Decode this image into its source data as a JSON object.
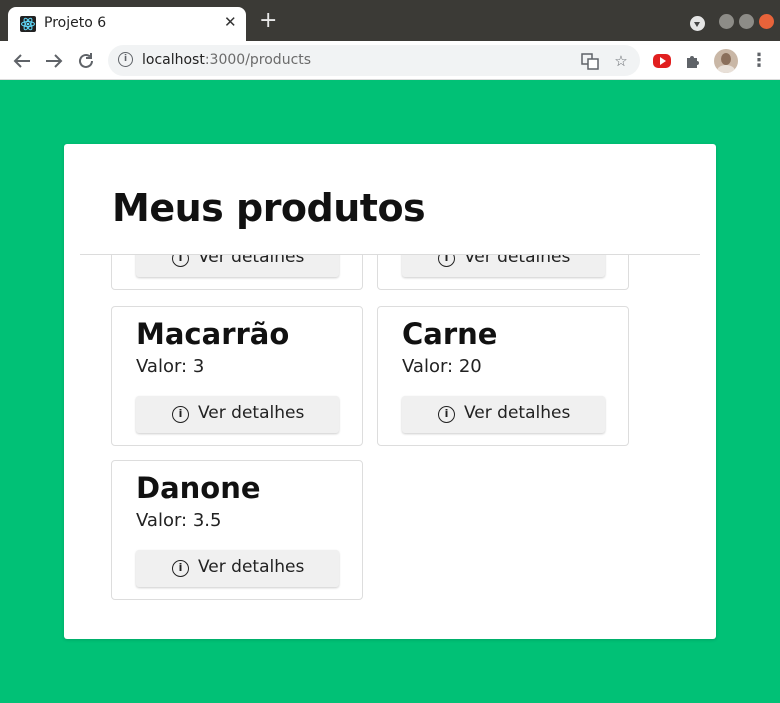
{
  "browser": {
    "tab_title": "Projeto 6",
    "tab_close": "✕",
    "new_tab": "+",
    "url_host": "localhost",
    "url_path": ":3000/products"
  },
  "page": {
    "title": "Meus produtos"
  },
  "products": [
    {
      "name": "",
      "price": "",
      "button": "Ver detalhes"
    },
    {
      "name": "",
      "price": "",
      "button": "Ver detalhes"
    },
    {
      "name": "Macarrão",
      "price": "Valor: 3",
      "button": "Ver detalhes"
    },
    {
      "name": "Carne",
      "price": "Valor: 20",
      "button": "Ver detalhes"
    },
    {
      "name": "Danone",
      "price": "Valor: 3.5",
      "button": "Ver detalhes"
    }
  ],
  "colors": {
    "background": "#01c176",
    "card": "#ffffff",
    "button": "#f0f0f0"
  }
}
